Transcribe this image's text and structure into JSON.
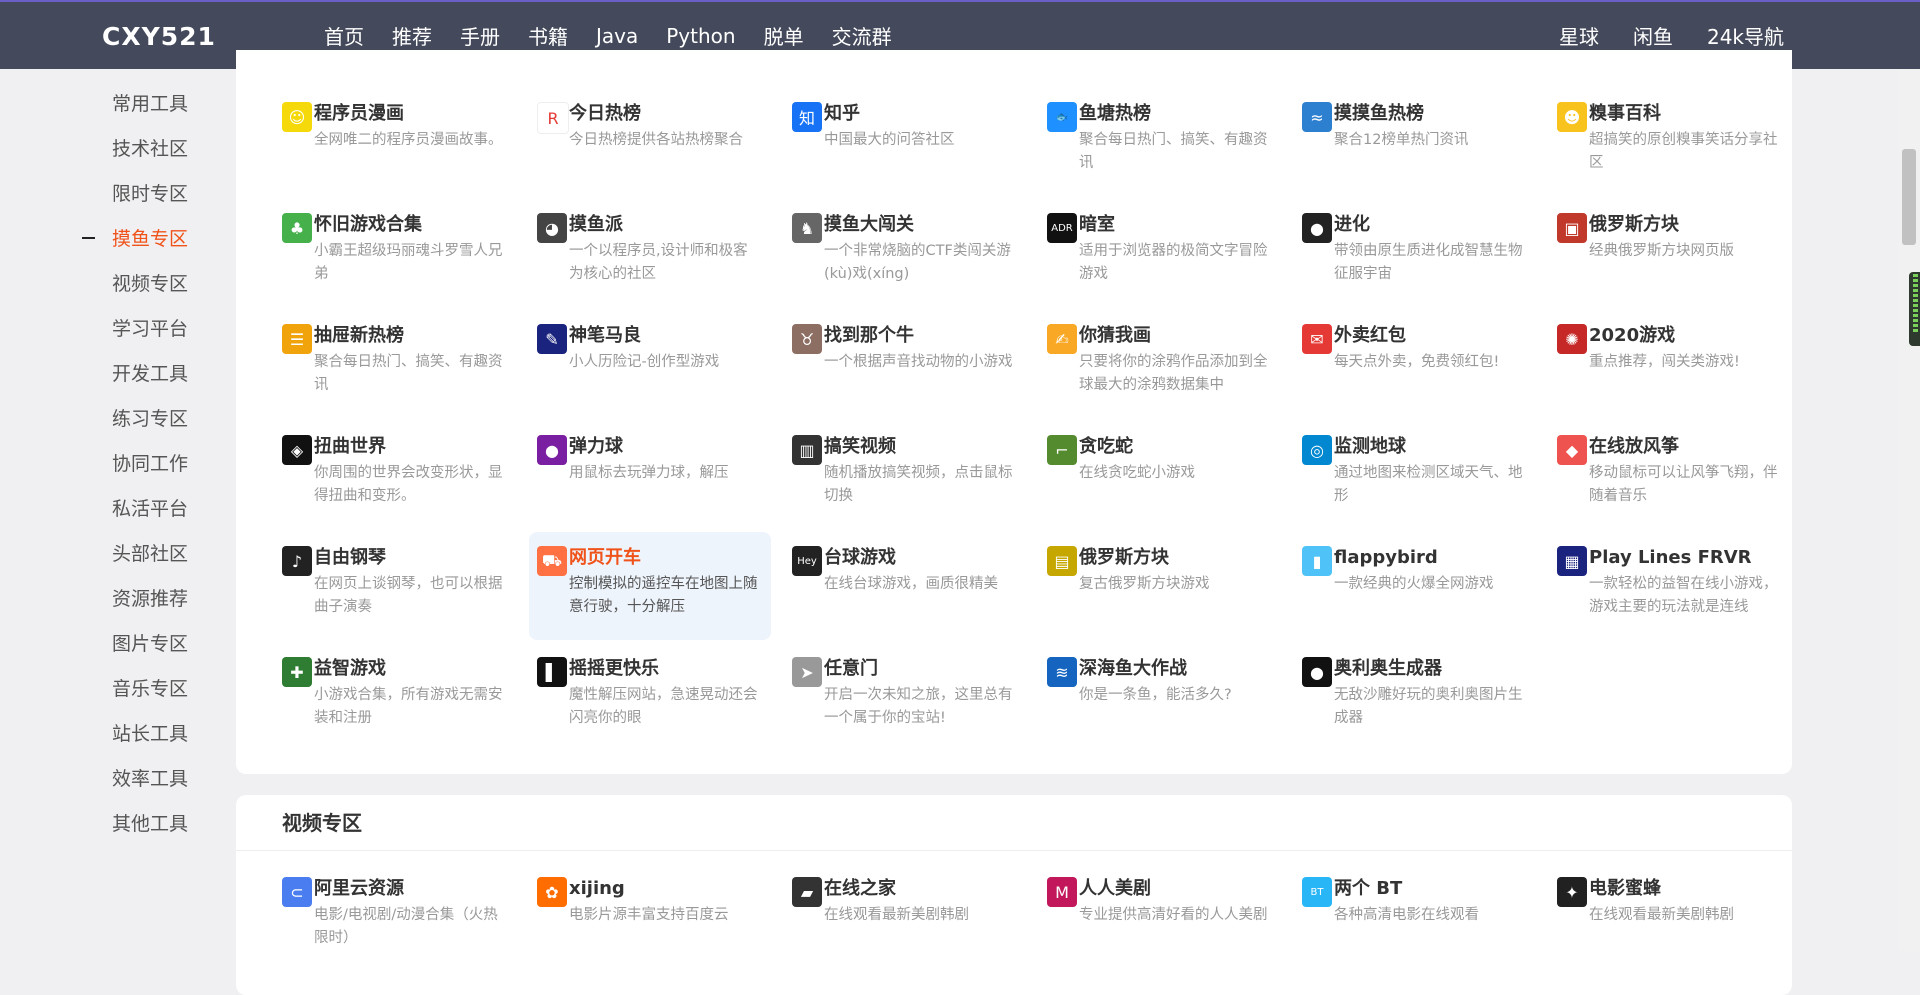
{
  "header": {
    "logo": "CXY521",
    "nav": [
      "首页",
      "推荐",
      "手册",
      "书籍",
      "Java",
      "Python",
      "脱单",
      "交流群"
    ],
    "nav_right": [
      "星球",
      "闲鱼",
      "24k导航"
    ]
  },
  "sidebar": {
    "active_index": 3,
    "items": [
      "常用工具",
      "技术社区",
      "限时专区",
      "摸鱼专区",
      "视频专区",
      "学习平台",
      "开发工具",
      "练习专区",
      "协同工作",
      "私活平台",
      "头部社区",
      "资源推荐",
      "图片专区",
      "音乐专区",
      "站长工具",
      "效率工具",
      "其他工具"
    ]
  },
  "fish_section": {
    "items": [
      {
        "title": "程序员漫画",
        "desc": "全网唯二的程序员漫画故事。",
        "icon": "smiley-icon",
        "color": "#f5d90a"
      },
      {
        "title": "今日热榜",
        "desc": "今日热榜提供各站热榜聚合",
        "icon": "rebang-icon",
        "color": "#ffffff"
      },
      {
        "title": "知乎",
        "desc": "中国最大的问答社区",
        "icon": "zhihu-icon",
        "color": "#1772f6"
      },
      {
        "title": "鱼塘热榜",
        "desc": "聚合每日热门、搞笑、有趣资讯",
        "icon": "fish-icon",
        "color": "#1e90ff"
      },
      {
        "title": "摸摸鱼热榜",
        "desc": "聚合12榜单热门资讯",
        "icon": "fish-blue-icon",
        "color": "#2d7fd0"
      },
      {
        "title": "糗事百科",
        "desc": "超搞笑的原创糗事笑话分享社区",
        "icon": "qiubai-icon",
        "color": "#f8c31d"
      },
      {
        "title": "怀旧游戏合集",
        "desc": "小霸王超级玛丽魂斗罗雪人兄弟",
        "icon": "retro-game-icon",
        "color": "#46b04a"
      },
      {
        "title": "摸鱼派",
        "desc": "一个以程序员,设计师和极客为核心的社区",
        "icon": "fishpi-icon",
        "color": "#444444"
      },
      {
        "title": "摸鱼大闯关",
        "desc": "一个非常烧脑的CTF类闯关游(kù)戏(xíng)",
        "icon": "ctf-icon",
        "color": "#666666"
      },
      {
        "title": "暗室",
        "desc": "适用于浏览器的极简文字冒险游戏",
        "icon": "adr-icon",
        "color": "#111111"
      },
      {
        "title": "进化",
        "desc": "带领由原生质进化成智慧生物征服宇宙",
        "icon": "globe-icon",
        "color": "#222222"
      },
      {
        "title": "俄罗斯方块",
        "desc": "经典俄罗斯方块网页版",
        "icon": "tetris-icon",
        "color": "#c0392b"
      },
      {
        "title": "抽屉新热榜",
        "desc": "聚合每日热门、搞笑、有趣资讯",
        "icon": "drawer-icon",
        "color": "#f0a30a"
      },
      {
        "title": "神笔马良",
        "desc": "小人历险记-创作型游戏",
        "icon": "pen-icon",
        "color": "#1a237e"
      },
      {
        "title": "找到那个牛",
        "desc": "一个根据声音找动物的小游戏",
        "icon": "cow-icon",
        "color": "#8d6e63"
      },
      {
        "title": "你猜我画",
        "desc": "只要将你的涂鸦作品添加到全球最大的涂鸦数据集中",
        "icon": "hand-pen-icon",
        "color": "#f9a825"
      },
      {
        "title": "外卖红包",
        "desc": "每天点外卖，免费领红包!",
        "icon": "red-envelope-icon",
        "color": "#e53935"
      },
      {
        "title": "2020游戏",
        "desc": "重点推荐，闯关类游戏!",
        "icon": "virus-icon",
        "color": "#c62828"
      },
      {
        "title": "扭曲世界",
        "desc": "你周围的世界会改变形状，显得扭曲和变形。",
        "icon": "twist-icon",
        "color": "#111111"
      },
      {
        "title": "弹力球",
        "desc": "用鼠标去玩弹力球，解压",
        "icon": "ball-icon",
        "color": "#7b1fa2"
      },
      {
        "title": "搞笑视频",
        "desc": "随机播放搞笑视频，点击鼠标切换",
        "icon": "tv-bars-icon",
        "color": "#333333"
      },
      {
        "title": "贪吃蛇",
        "desc": "在线贪吃蛇小游戏",
        "icon": "snake-icon",
        "color": "#558b2f"
      },
      {
        "title": "监测地球",
        "desc": "通过地图来检测区域天气、地形",
        "icon": "earth-icon",
        "color": "#0288d1"
      },
      {
        "title": "在线放风筝",
        "desc": "移动鼠标可以让风筝飞翔，伴随着音乐",
        "icon": "kite-icon",
        "color": "#ef5350"
      },
      {
        "title": "自由钢琴",
        "desc": "在网页上谈钢琴，也可以根据曲子演奏",
        "icon": "piano-icon",
        "color": "#222222"
      },
      {
        "title": "网页开车",
        "desc": "控制模拟的遥控车在地图上随意行驶，十分解压",
        "icon": "car-icon",
        "color": "#ff7043"
      },
      {
        "title": "台球游戏",
        "desc": "在线台球游戏，画质很精美",
        "icon": "hey-icon",
        "color": "#222222"
      },
      {
        "title": "俄罗斯方块",
        "desc": "复古俄罗斯方块游戏",
        "icon": "gameboy-icon",
        "color": "#c6a700"
      },
      {
        "title": "flappybird",
        "desc": "一款经典的火爆全网游戏",
        "icon": "flappybird-icon",
        "color": "#4fc3f7"
      },
      {
        "title": "Play Lines FRVR",
        "desc": "一款轻松的益智在线小游戏，游戏主要的玩法就是连线",
        "icon": "lines-icon",
        "color": "#1a237e"
      },
      {
        "title": "益智游戏",
        "desc": "小游戏合集，所有游戏无需安装和注册",
        "icon": "puzzle-icon",
        "color": "#2e7d32"
      },
      {
        "title": "摇摇更快乐",
        "desc": "魔性解压网站，急速晃动还会闪亮你的眼",
        "icon": "shake-icon",
        "color": "#111111"
      },
      {
        "title": "任意门",
        "desc": "开启一次未知之旅，这里总有一个属于你的宝站!",
        "icon": "send-icon",
        "color": "#999999"
      },
      {
        "title": "深海鱼大作战",
        "desc": "你是一条鱼，能活多久?",
        "icon": "deep-fish-icon",
        "color": "#1565c0"
      },
      {
        "title": "奥利奥生成器",
        "desc": "无敌沙雕好玩的奥利奥图片生成器",
        "icon": "oreo-icon",
        "color": "#111111"
      }
    ]
  },
  "video_section": {
    "title": "视频专区",
    "items": [
      {
        "title": "阿里云资源",
        "desc": "电影/电视剧/动漫合集（火热限时）",
        "icon": "aliyun-icon",
        "color": "#4a7ef0"
      },
      {
        "title": "xijing",
        "desc": "电影片源丰富支持百度云",
        "icon": "xijing-icon",
        "color": "#ff6d00"
      },
      {
        "title": "在线之家",
        "desc": "在线观看最新美剧韩剧",
        "icon": "clapper-icon",
        "color": "#333333"
      },
      {
        "title": "人人美剧",
        "desc": "专业提供高清好看的人人美剧",
        "icon": "renren-icon",
        "color": "#c2185b"
      },
      {
        "title": "两个 BT",
        "desc": "各种高清电影在线观看",
        "icon": "bt-icon",
        "color": "#29b6f6"
      },
      {
        "title": "电影蜜蜂",
        "desc": "在线观看最新美剧韩剧",
        "icon": "bee-icon",
        "color": "#212121"
      }
    ]
  }
}
